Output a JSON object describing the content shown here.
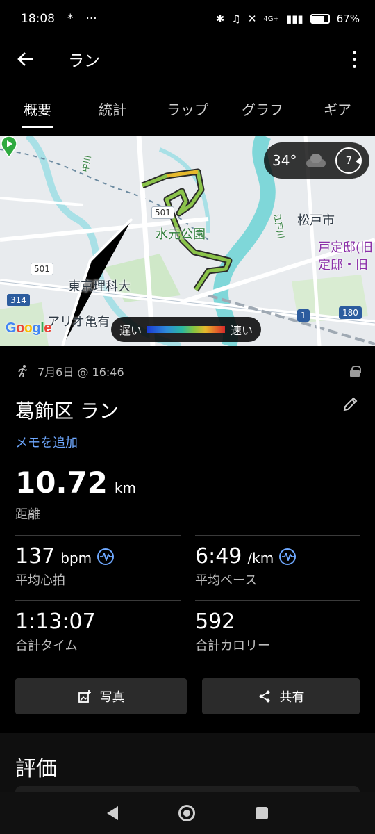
{
  "status_bar": {
    "time": "18:08",
    "notification_glyph": "*",
    "more_glyph": "···",
    "network": "4G+",
    "battery": "67%"
  },
  "app_bar": {
    "title": "ラン"
  },
  "tabs": [
    {
      "label": "概要",
      "active": true
    },
    {
      "label": "統計",
      "active": false
    },
    {
      "label": "ラップ",
      "active": false
    },
    {
      "label": "グラフ",
      "active": false
    },
    {
      "label": "ギア",
      "active": false
    }
  ],
  "map": {
    "labels": {
      "matsudo": "松戸市",
      "park": "水元公園",
      "college": "東京理科大",
      "ario": "アリオ亀有",
      "tojo1": "戸定邸(旧",
      "tojo2": "定邸・旧",
      "edogawa": "江戸川",
      "nakagawa": "中川"
    },
    "road_badges": {
      "r501a": "501",
      "r501b": "501",
      "r314": "314",
      "r180": "180",
      "r1": "1"
    },
    "weather": {
      "temperature": "34°",
      "wind": "7"
    },
    "legend": {
      "slow": "遅い",
      "fast": "速い"
    },
    "google": "Google"
  },
  "activity": {
    "date": "7月6日 @ 16:46",
    "title": "葛飾区 ラン",
    "add_memo": "メモを追加",
    "distance": {
      "value": "10.72",
      "unit": "km",
      "label": "距離"
    }
  },
  "stats": {
    "heart_rate": {
      "value": "137",
      "unit": "bpm",
      "label": "平均心拍"
    },
    "pace": {
      "value": "6:49",
      "unit": "/km",
      "label": "平均ペース"
    },
    "time": {
      "value": "1:13:07",
      "label": "合計タイム"
    },
    "calories": {
      "value": "592",
      "label": "合計カロリー"
    }
  },
  "buttons": {
    "photo": "写真",
    "share": "共有"
  },
  "rating": {
    "title": "評価"
  },
  "colors": {
    "accent": "#6ea8ff",
    "route": "#8bc34a",
    "button_bg": "#2b2b2b"
  }
}
